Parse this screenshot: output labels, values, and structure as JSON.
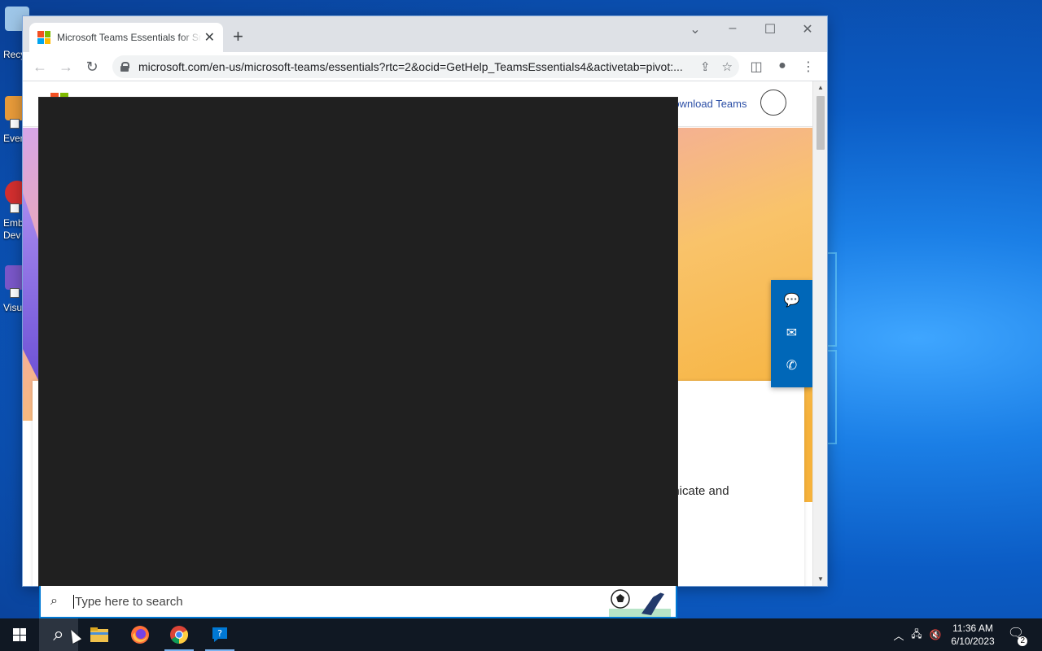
{
  "desktop": {
    "icons": [
      {
        "label": "Recycle Bin",
        "color": "#9ec6e8"
      },
      {
        "label": "Everything",
        "color": "#e89b3a"
      },
      {
        "label": "Embarcadero Dev",
        "color": "#d32f2f"
      },
      {
        "label": "Visual Studio",
        "color": "#7a57c9"
      }
    ]
  },
  "browser": {
    "tab": {
      "title": "Microsoft Teams Essentials for Small Business",
      "close": "✕"
    },
    "new_tab": "+",
    "window_controls": {
      "dropdown": "⌄",
      "minimize": "–",
      "maximize": "☐",
      "close": "✕"
    },
    "nav": {
      "back": "←",
      "forward": "→",
      "reload": "↻"
    },
    "address": {
      "url": "microsoft.com/en-us/microsoft-teams/essentials?rtc=2&ocid=GetHelp_TeamsEssentials4&activetab=pivot:..."
    },
    "toolbar_icons": {
      "share": "⇪",
      "bookmark": "☆",
      "side_panel": "◫",
      "profile": "●",
      "menu": "⋮"
    }
  },
  "page": {
    "download_link": "Download Teams",
    "body_text_fragment": "unicate and",
    "contact_rail": {
      "chat": "💬",
      "email": "✉",
      "phone": "✆"
    }
  },
  "search": {
    "placeholder": "Type here to search",
    "glass": "⌕"
  },
  "taskbar": {
    "search_icon": "⌕",
    "apps": [
      "File Explorer",
      "Firefox",
      "Chrome",
      "Get Help"
    ],
    "tray": {
      "chevron": "︿",
      "network": "🖧",
      "volume": "🔇"
    },
    "clock": {
      "time": "11:36 AM",
      "date": "6/10/2023"
    },
    "notifications": {
      "icon": "🗨",
      "count": "2"
    }
  },
  "colors": {
    "accent": "#0078d4",
    "contact_rail": "#0067b8",
    "taskbar": "#101823",
    "flyout": "#202020"
  }
}
